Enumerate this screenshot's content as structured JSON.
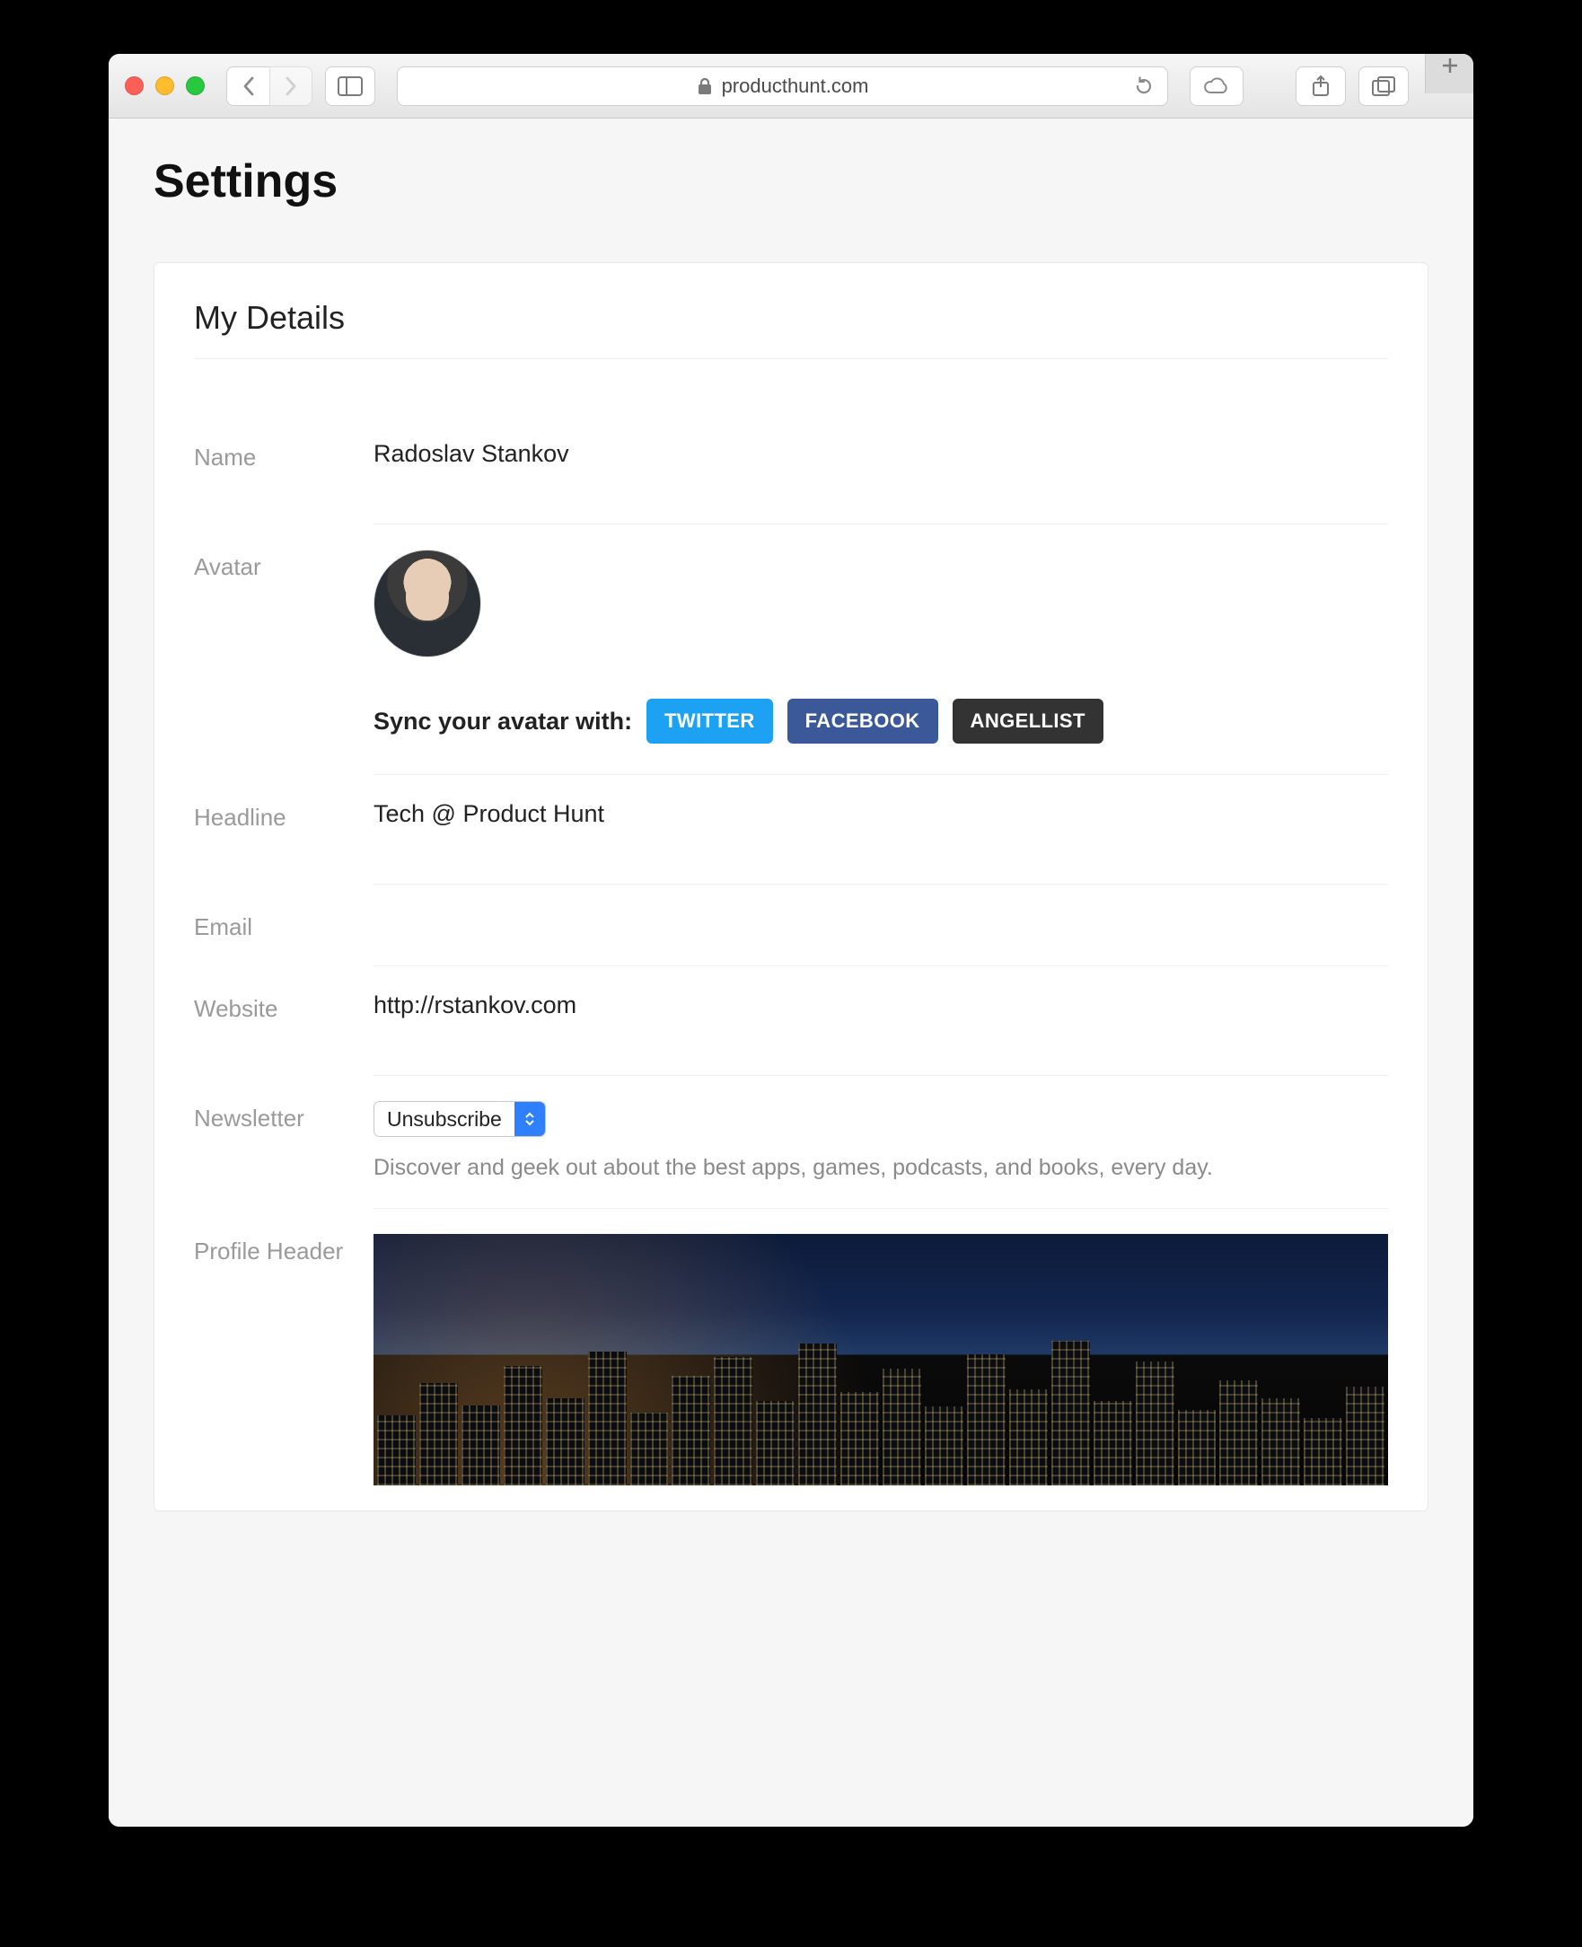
{
  "browser": {
    "domain": "producthunt.com"
  },
  "page": {
    "title": "Settings",
    "section_title": "My Details"
  },
  "labels": {
    "name": "Name",
    "avatar": "Avatar",
    "headline": "Headline",
    "email": "Email",
    "website": "Website",
    "newsletter": "Newsletter",
    "profile_header": "Profile Header"
  },
  "fields": {
    "name": "Radoslav Stankov",
    "sync_text": "Sync your avatar with:",
    "sync_buttons": {
      "twitter": "TWITTER",
      "facebook": "FACEBOOK",
      "angellist": "ANGELLIST"
    },
    "headline": "Tech @ Product Hunt",
    "email": "",
    "website": "http://rstankov.com",
    "newsletter_selected": "Unsubscribe",
    "newsletter_helper": "Discover and geek out about the best apps, games, podcasts, and books, every day."
  }
}
